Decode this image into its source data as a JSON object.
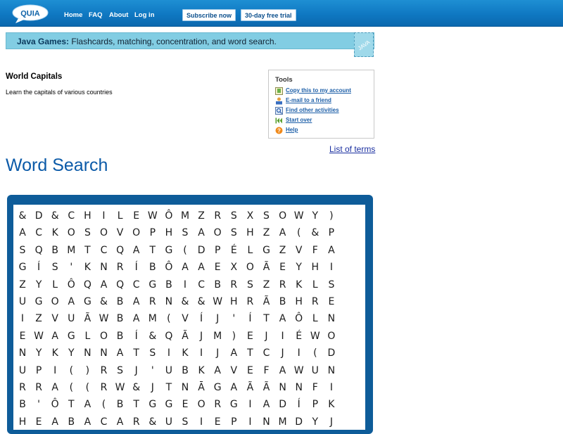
{
  "nav": {
    "logo_text": "QUIA",
    "links": [
      "Home",
      "FAQ",
      "About",
      "Log in"
    ],
    "subscribe_label": "Subscribe now",
    "trial_label": "30-day free trial"
  },
  "banner": {
    "bold": "Java Games:",
    "text": " Flashcards, matching, concentration, and word search.",
    "stamp_text": "JAVA"
  },
  "activity": {
    "title": "World Capitals",
    "description": "Learn the capitals of various countries"
  },
  "tools": {
    "title": "Tools",
    "items": [
      {
        "label": "Copy this to my account",
        "icon": "copy-icon"
      },
      {
        "label": "E-mail to a friend",
        "icon": "email-icon"
      },
      {
        "label": "Find other activities",
        "icon": "find-icon"
      },
      {
        "label": "Start over",
        "icon": "rewind-icon"
      },
      {
        "label": "Help",
        "icon": "help-icon"
      }
    ]
  },
  "list_of_terms": "List of terms",
  "heading": "Word Search",
  "colors": {
    "nav_bar": "#0f78c2",
    "banner": "#82cde3",
    "heading": "#0b5aa8",
    "puzzle_frame": "#0e5c99",
    "link": "#1d5fa8"
  },
  "grid": [
    [
      "&",
      "D",
      "&",
      "C",
      "H",
      "I",
      "L",
      "E",
      "W",
      "Ô",
      "M",
      "Z",
      "R",
      "S",
      "X",
      "S",
      "O",
      "W",
      "Y",
      ")"
    ],
    [
      "A",
      "C",
      "K",
      "O",
      "S",
      "O",
      "V",
      "O",
      "P",
      "H",
      "S",
      "A",
      "O",
      "S",
      "H",
      "Z",
      "A",
      "(",
      "&",
      "P"
    ],
    [
      "S",
      "Q",
      "B",
      "M",
      "T",
      "C",
      "Q",
      "A",
      "T",
      "G",
      "(",
      "D",
      "P",
      "É",
      "L",
      "G",
      "Z",
      "V",
      "F",
      "A"
    ],
    [
      "G",
      "Í",
      "S",
      "'",
      "K",
      "N",
      "R",
      "Í",
      "B",
      "Ô",
      "A",
      "A",
      "E",
      "X",
      "O",
      "Ã",
      "E",
      "Y",
      "H",
      "I"
    ],
    [
      "Z",
      "Y",
      "L",
      "Ô",
      "Q",
      "A",
      "Q",
      "C",
      "G",
      "B",
      "I",
      "C",
      "B",
      "R",
      "S",
      "Z",
      "R",
      "K",
      "L",
      "S"
    ],
    [
      "U",
      "G",
      "O",
      "A",
      "G",
      "&",
      "B",
      "A",
      "R",
      "N",
      "&",
      "&",
      "W",
      "H",
      "R",
      "Ã",
      "B",
      "H",
      "R",
      "E"
    ],
    [
      "I",
      "Z",
      "V",
      "U",
      "Ã",
      "W",
      "B",
      "A",
      "M",
      "(",
      "V",
      "Í",
      "J",
      "'",
      "Í",
      "T",
      "A",
      "Ô",
      "L",
      "N"
    ],
    [
      "E",
      "W",
      "A",
      "G",
      "L",
      "O",
      "B",
      "Í",
      "&",
      "Q",
      "Ã",
      "J",
      "M",
      ")",
      "E",
      "J",
      "I",
      "É",
      "W",
      "O"
    ],
    [
      "N",
      "Y",
      "K",
      "Y",
      "N",
      "N",
      "A",
      "T",
      "S",
      "I",
      "K",
      "I",
      "J",
      "A",
      "T",
      "C",
      "J",
      "I",
      "(",
      "D"
    ],
    [
      "U",
      "P",
      "I",
      "(",
      ")",
      "R",
      "S",
      "J",
      "'",
      "U",
      "B",
      "K",
      "A",
      "V",
      "E",
      "F",
      "A",
      "W",
      "U",
      "N"
    ],
    [
      "R",
      "R",
      "A",
      "(",
      "(",
      "R",
      "W",
      "&",
      "J",
      "T",
      "N",
      "Ā",
      "G",
      "A",
      "Ã",
      "Ã",
      "N",
      "N",
      "F",
      "I"
    ],
    [
      "B",
      "'",
      "Ô",
      "T",
      "A",
      "(",
      "B",
      "T",
      "G",
      "G",
      "E",
      "O",
      "R",
      "G",
      "I",
      "A",
      "D",
      "Í",
      "P",
      "K"
    ],
    [
      "H",
      "E",
      "A",
      "B",
      "A",
      "C",
      "A",
      "R",
      "&",
      "U",
      "S",
      "I",
      "E",
      "P",
      "I",
      "N",
      "M",
      "D",
      "Y",
      "J"
    ]
  ]
}
